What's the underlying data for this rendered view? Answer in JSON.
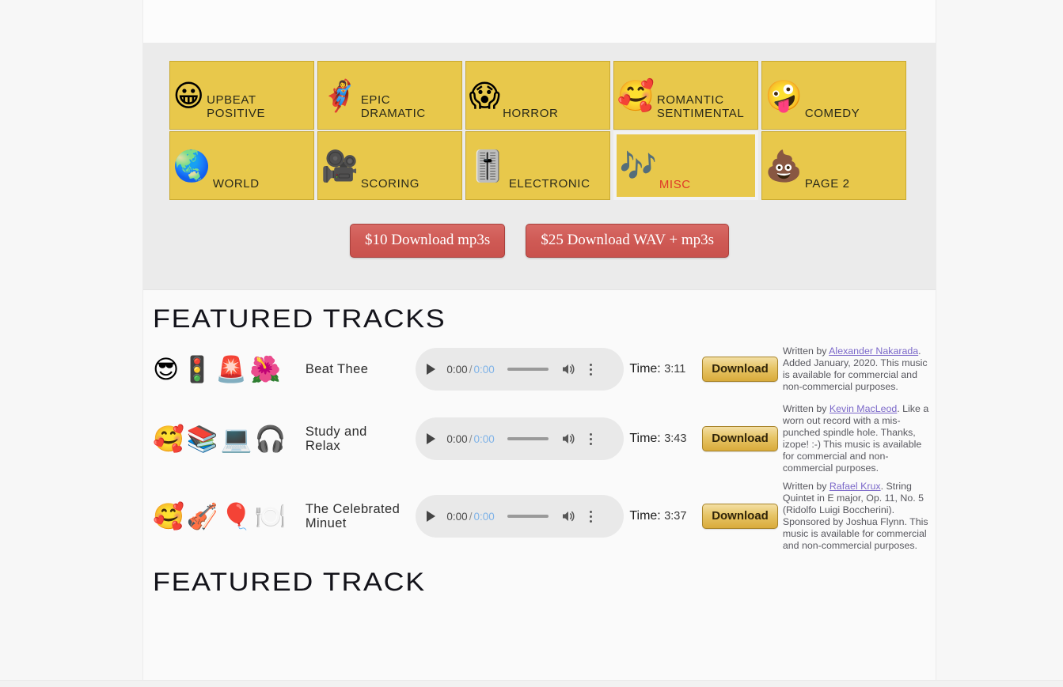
{
  "categories": [
    {
      "id": "upbeat-positive",
      "emoji": "😀",
      "icon_name": "grinning-face-icon",
      "label": "UPBEAT\nPOSITIVE",
      "active": false
    },
    {
      "id": "epic-dramatic",
      "emoji": "🦸‍♀️",
      "icon_name": "superhero-woman-icon",
      "label": "EPIC\nDRAMATIC",
      "active": false
    },
    {
      "id": "horror",
      "emoji": "😱",
      "icon_name": "screaming-face-icon",
      "label": "HORROR",
      "active": false
    },
    {
      "id": "romantic-sentimental",
      "emoji": "🥰",
      "icon_name": "smiling-face-with-hearts-icon",
      "label": "ROMANTIC\nSENTIMENTAL",
      "active": false
    },
    {
      "id": "comedy",
      "emoji": "🤪",
      "icon_name": "zany-face-icon",
      "label": "COMEDY",
      "active": false
    },
    {
      "id": "world",
      "emoji": "🌏",
      "icon_name": "globe-asia-icon",
      "label": "WORLD",
      "active": false
    },
    {
      "id": "scoring",
      "emoji": "🎥",
      "icon_name": "movie-camera-icon",
      "label": "SCORING",
      "active": false
    },
    {
      "id": "electronic",
      "emoji": "🎚️",
      "icon_name": "level-slider-icon",
      "label": "ELECTRONIC",
      "active": false
    },
    {
      "id": "misc",
      "emoji": "🎶",
      "icon_name": "musical-notes-icon",
      "label": "MISC",
      "active": true
    },
    {
      "id": "page-2",
      "emoji": "💩",
      "icon_name": "pile-of-poo-icon",
      "label": "PAGE 2",
      "active": false
    }
  ],
  "purchase": {
    "mp3_label": "$10 Download mp3s",
    "wav_label": "$25 Download WAV + mp3s"
  },
  "headings": {
    "featured_tracks": "FEATURED TRACKS",
    "featured_track": "FEATURED TRACK"
  },
  "player": {
    "current_time": "0:00",
    "separator": "/",
    "duration": "0:00",
    "play_icon": "play-icon",
    "volume_icon": "volume-icon",
    "menu_icon": "kebab-menu-icon"
  },
  "labels": {
    "time_prefix": "Time:",
    "download": "Download"
  },
  "colors": {
    "tile": "#e8c84b",
    "tile_border": "#c9a92f",
    "active_label": "#e03a28",
    "buy_button": "#cf5a55",
    "download_button": "#e7c567",
    "link": "#7b68c9"
  },
  "tracks": [
    {
      "emojis": "😎🚦🚨🌺",
      "emoji_names": "smiling-face-with-sunglasses, vertical-traffic-light, police-car-light, hibiscus",
      "title": "Beat Thee",
      "time": "3:11",
      "credit_prefix": "Written by ",
      "credit_link": "Alexander Nakarada",
      "credit_suffix": ". Added January, 2020. This music is available for commercial and non-commercial purposes."
    },
    {
      "emojis": "🥰📚💻🎧",
      "emoji_names": "smiling-face-with-hearts, books, laptop, headphone",
      "title": "Study and Relax",
      "time": "3:43",
      "credit_prefix": "Written by ",
      "credit_link": "Kevin MacLeod",
      "credit_suffix": ". Like a worn out record with a mis-punched spindle hole. Thanks, izope! :-) This music is available for commercial and non-commercial purposes."
    },
    {
      "emojis": "🥰🎻🎈🍽️",
      "emoji_names": "smiling-face-with-hearts, violin, balloon, fork-and-knife-with-plate",
      "title": "The Celebrated Minuet",
      "time": "3:37",
      "credit_prefix": "Written by ",
      "credit_link": "Rafael Krux",
      "credit_suffix": ". String Quintet in E major, Op. 11, No. 5 (Ridolfo Luigi Boccherini). Sponsored by Joshua Flynn. This music is available for commercial and non-commercial purposes."
    }
  ]
}
